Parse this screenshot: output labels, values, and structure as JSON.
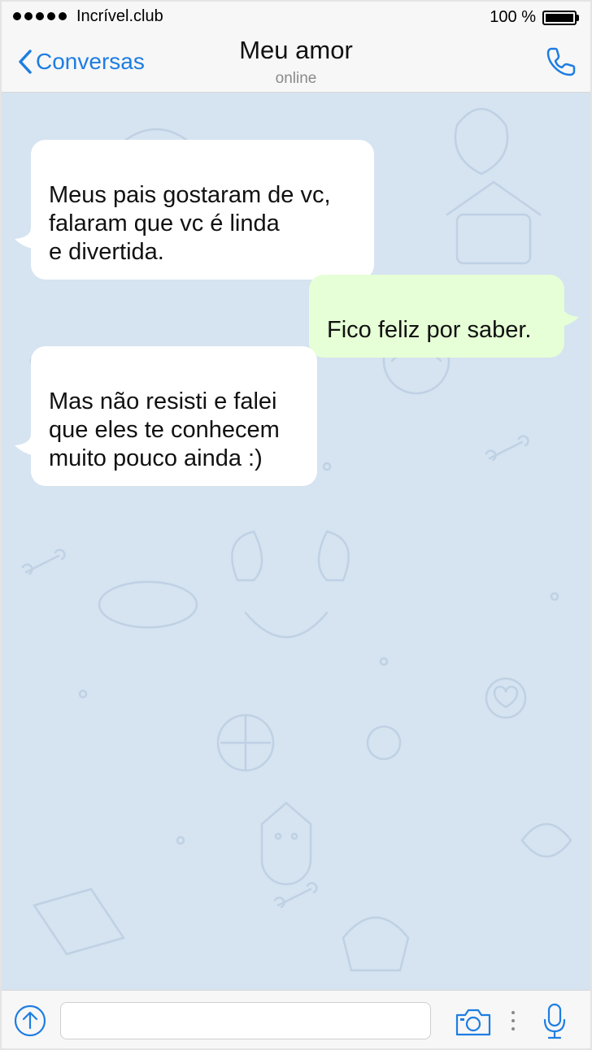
{
  "status_bar": {
    "carrier": "Incrível.club",
    "battery": "100 %"
  },
  "nav": {
    "back_label": "Conversas",
    "title": "Meu amor",
    "subtitle": "online"
  },
  "messages": [
    {
      "direction": "incoming",
      "text": "Meus pais gostaram de vc,\nfalaram que vc é linda\ne divertida."
    },
    {
      "direction": "outgoing",
      "text": "Fico feliz por saber."
    },
    {
      "direction": "incoming",
      "text": "Mas não resisti e falei\nque eles te conhecem\nmuito pouco ainda :)"
    }
  ],
  "input": {
    "value": "",
    "placeholder": ""
  },
  "icons": [
    "signal-icon",
    "battery-icon",
    "back-chevron-icon",
    "phone-icon",
    "attach-icon",
    "camera-icon",
    "more-dots-icon",
    "microphone-icon"
  ],
  "colors": {
    "accent": "#1e7de2",
    "incoming_bubble": "#ffffff",
    "outgoing_bubble": "#e6ffd6",
    "chat_background": "#d6e3f0"
  }
}
